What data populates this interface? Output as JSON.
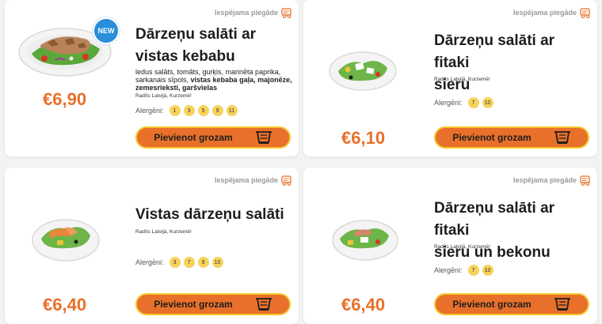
{
  "delivery_label": "Iespējama piegāde",
  "add_button_label": "Pievienot grozam",
  "allergens_label": "Alergēni:",
  "new_badge": "NEW",
  "colors": {
    "accent": "#e8702a",
    "button_border": "#f6c62c",
    "chip": "#f7d35c",
    "badge": "#2a8fd8"
  },
  "products": [
    {
      "title_line1": "Dārzeņu salāti ar",
      "title_line2": "vistas kebabu",
      "desc_plain": "ledus salāts, tomāts, gurķis, marinēta paprika, sarkanais sīpols, ",
      "desc_bold": "vistas kebaba gaļa, majonēze, zemesrieksti, garšvielas",
      "origin": "Radīts Latvijā, Kurzemē!",
      "allergens": [
        "1",
        "3",
        "5",
        "9",
        "11"
      ],
      "price": "€6,90"
    },
    {
      "title_line1": "Dārzeņu salāti ar fitaki",
      "title_line2": "sieru",
      "origin": "Radīts Latvijā, Kurzemē!",
      "allergens": [
        "7",
        "10"
      ],
      "price": "€6,10"
    },
    {
      "title_line1": "Vistas dārzeņu salāti",
      "origin": "Radīts Latvijā, Kurzemē!",
      "allergens": [
        "3",
        "7",
        "9",
        "10"
      ],
      "price": "€6,40"
    },
    {
      "title_line1": "Dārzeņu salāti ar fitaki",
      "title_line2": "sieru un bekonu",
      "origin": "Radīts Latvijā, Kurzemē!",
      "allergens": [
        "7",
        "10"
      ],
      "price": "€6,40"
    }
  ]
}
